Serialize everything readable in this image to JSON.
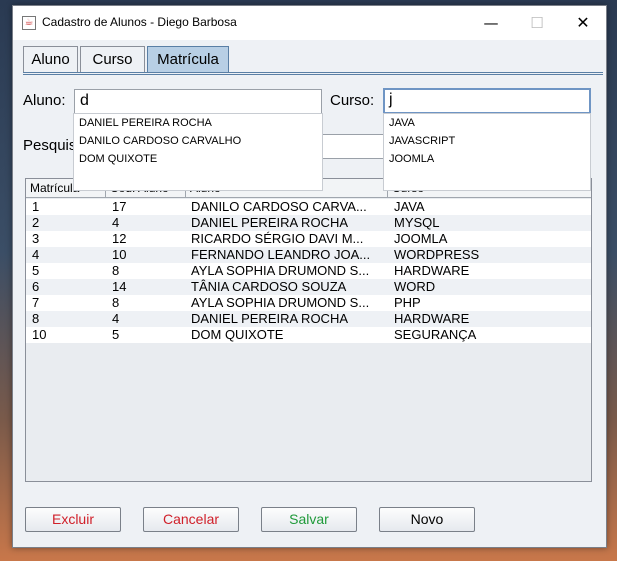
{
  "window": {
    "title": "Cadastro de Alunos - Diego Barbosa",
    "icon": "java-icon"
  },
  "controls": {
    "minimize": "—",
    "maximize": "☐",
    "close": "✕"
  },
  "tabs": [
    {
      "label": "Aluno"
    },
    {
      "label": "Curso"
    },
    {
      "label": "Matrícula"
    }
  ],
  "form": {
    "aluno_label": "Aluno:",
    "aluno_value": "d",
    "curso_label": "Curso:",
    "curso_value": "j",
    "pesquisa_label": "Pesquisar:"
  },
  "aluno_suggestions": [
    "DANIEL PEREIRA ROCHA",
    "DANILO CARDOSO CARVALHO",
    "DOM QUIXOTE"
  ],
  "curso_suggestions": [
    "JAVA",
    "JAVASCRIPT",
    "JOOMLA"
  ],
  "table": {
    "columns": [
      "Matrícula",
      "Cód. Aluno",
      "Aluno",
      "Curso"
    ],
    "rows": [
      [
        "1",
        "17",
        "DANILO CARDOSO CARVA...",
        "JAVA"
      ],
      [
        "2",
        "4",
        "DANIEL PEREIRA ROCHA",
        "MYSQL"
      ],
      [
        "3",
        "12",
        "RICARDO SÉRGIO DAVI M...",
        "JOOMLA"
      ],
      [
        "4",
        "10",
        "FERNANDO LEANDRO JOA...",
        "WORDPRESS"
      ],
      [
        "5",
        "8",
        "AYLA SOPHIA DRUMOND S...",
        "HARDWARE"
      ],
      [
        "6",
        "14",
        "TÂNIA CARDOSO SOUZA",
        "WORD"
      ],
      [
        "7",
        "8",
        "AYLA SOPHIA DRUMOND S...",
        "PHP"
      ],
      [
        "8",
        "4",
        "DANIEL PEREIRA ROCHA",
        "HARDWARE"
      ],
      [
        "10",
        "5",
        "DOM QUIXOTE",
        "SEGURANÇA"
      ]
    ]
  },
  "buttons": {
    "excluir": {
      "label": "Excluir",
      "color": "#d0202a"
    },
    "cancelar": {
      "label": "Cancelar",
      "color": "#d0202a"
    },
    "salvar": {
      "label": "Salvar",
      "color": "#1f9a3a"
    },
    "novo": {
      "label": "Novo",
      "color": "#000000"
    }
  }
}
